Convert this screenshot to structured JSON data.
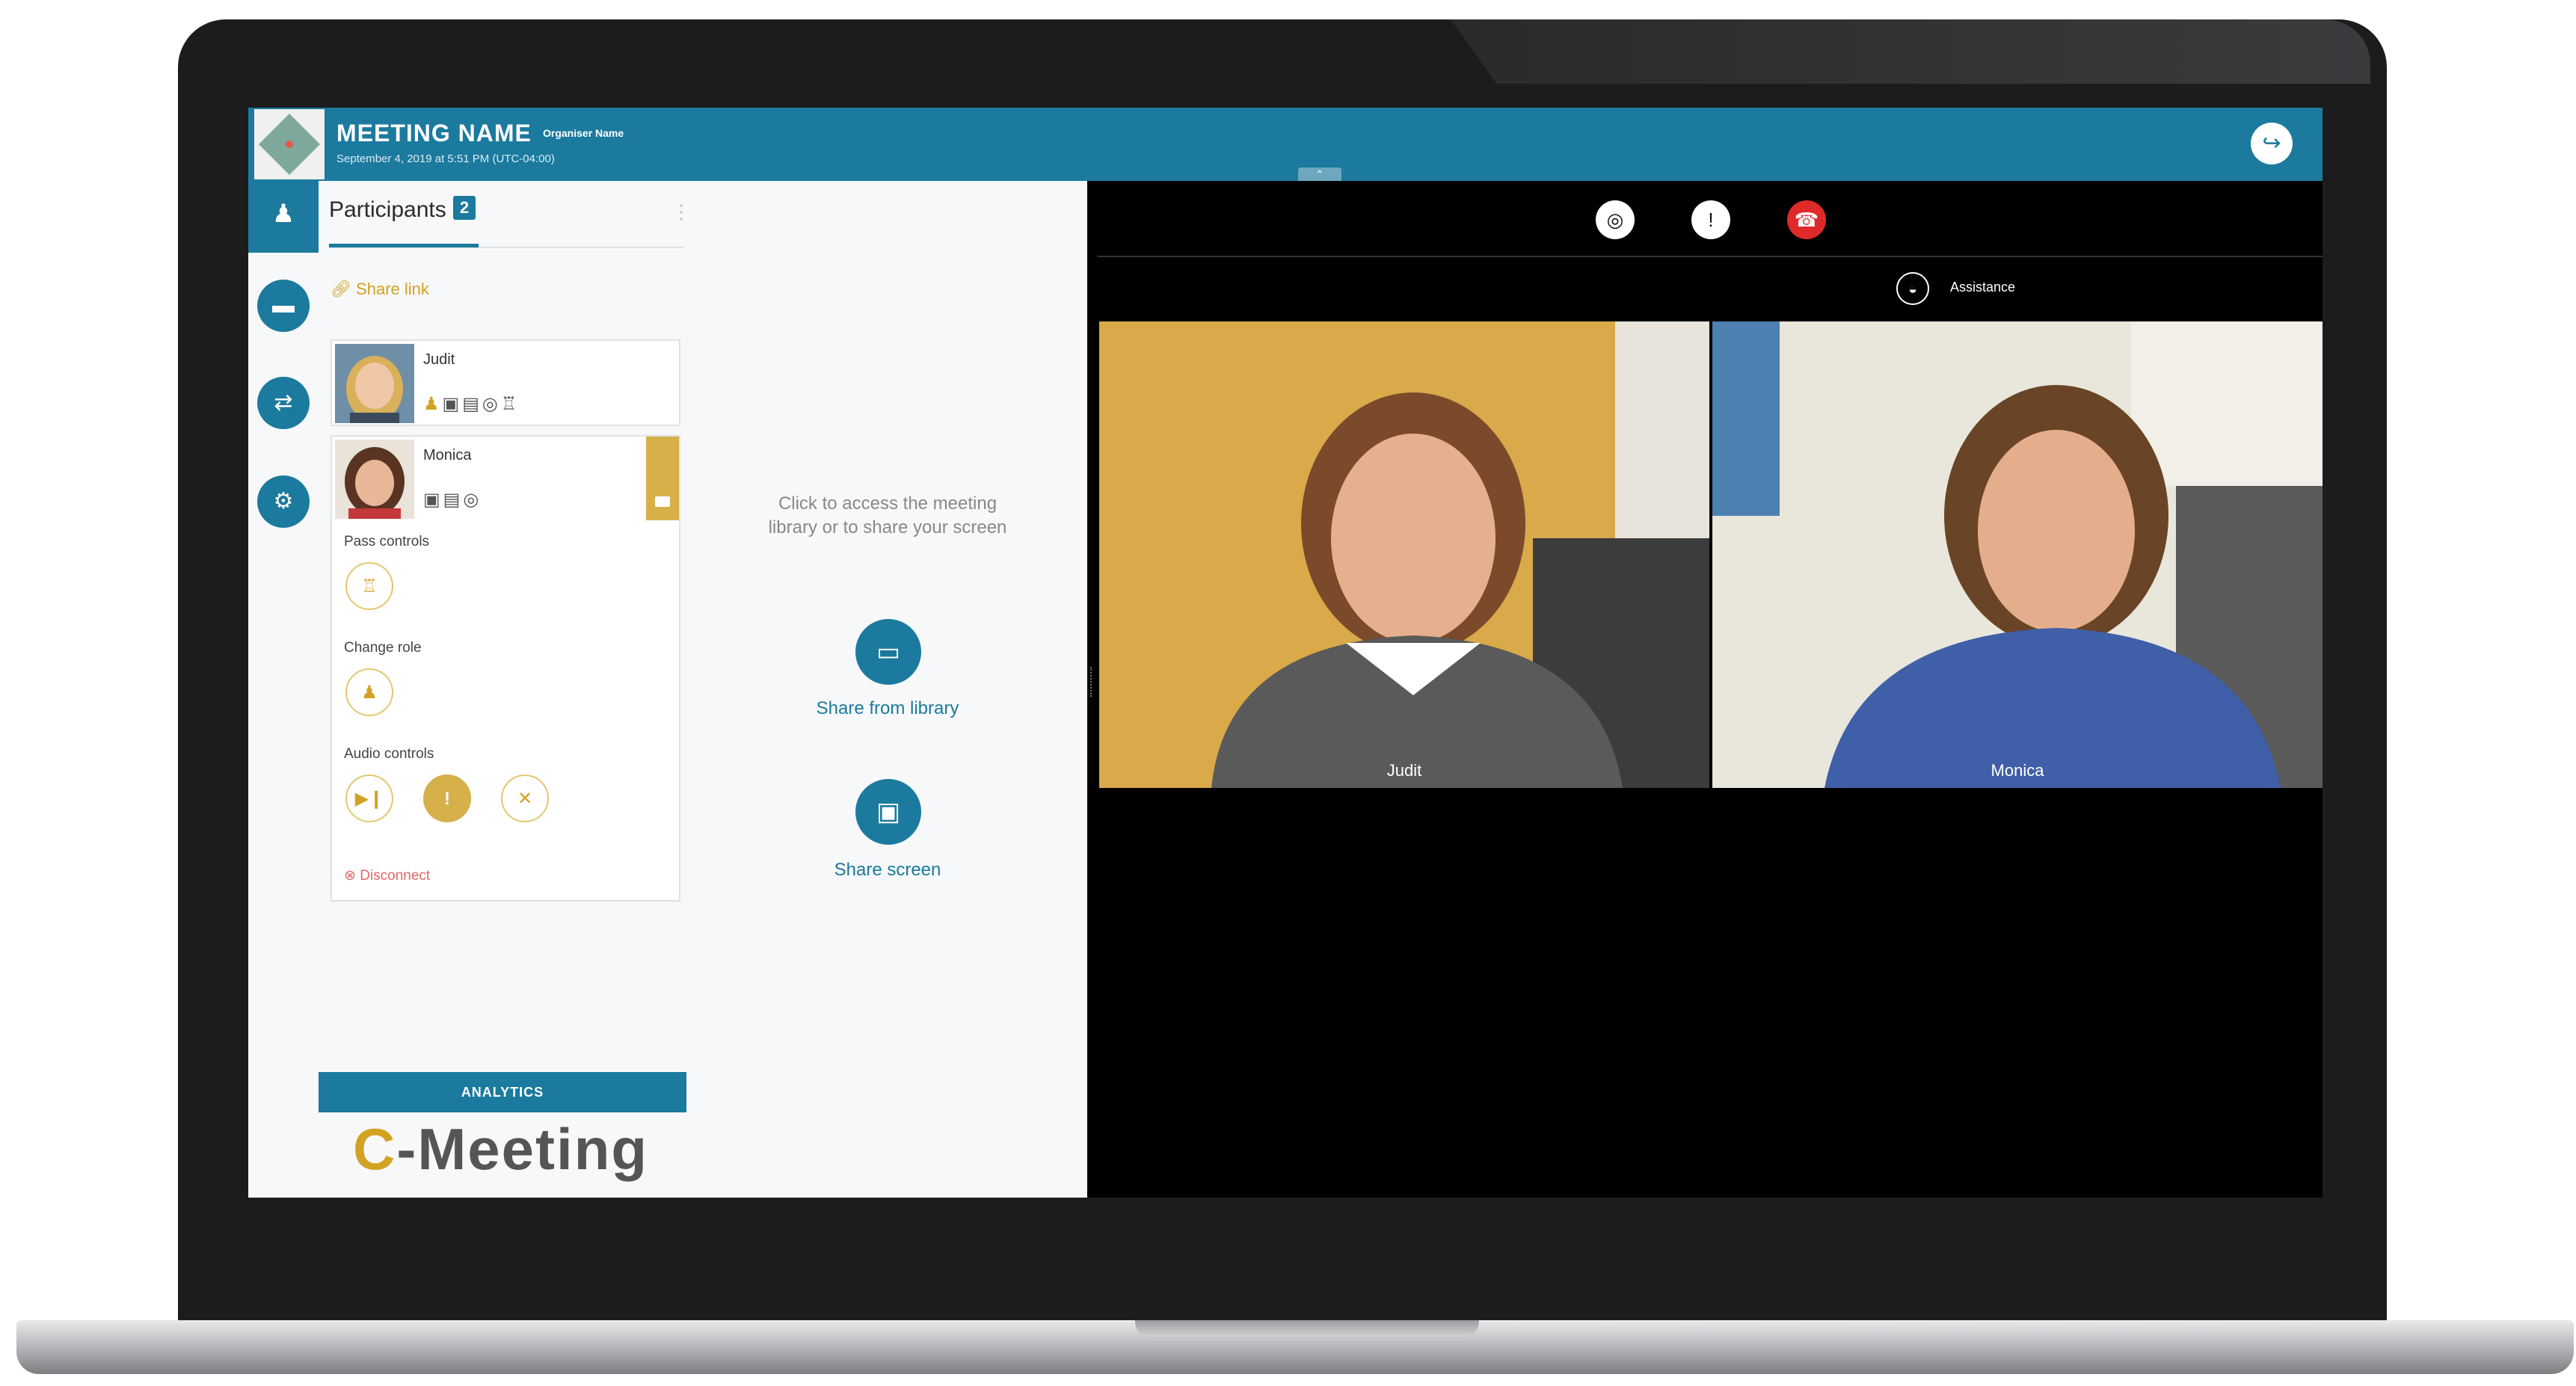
{
  "header": {
    "meeting_name": "MEETING NAME",
    "organiser": "Organiser Name",
    "date": "September 4, 2019 at 5:51 PM (UTC-04:00)"
  },
  "participants": {
    "tab_label": "Participants",
    "count": "2",
    "share_link": "Share link",
    "list": [
      {
        "name": "Judit"
      },
      {
        "name": "Monica"
      }
    ],
    "controls": {
      "pass_controls": "Pass controls",
      "change_role": "Change role",
      "audio_controls": "Audio controls",
      "disconnect": "Disconnect"
    }
  },
  "share": {
    "hint": "Click to access the meeting library or to share your screen",
    "library_label": "Share from library",
    "screen_label": "Share screen"
  },
  "sidebar": {
    "analytics_label": "ANALYTICS",
    "brand_c": "C",
    "brand_rest": "-Meeting"
  },
  "video": {
    "assistance_label": "Assistance",
    "tiles": [
      {
        "name": "Judit"
      },
      {
        "name": "Monica"
      }
    ]
  },
  "colors": {
    "primary": "#1b7a9e",
    "accent_gold": "#d2a222",
    "hangup_red": "#e02a2a"
  },
  "icons": [
    "camera-icon",
    "microphone-icon",
    "hangup-icon",
    "exit-icon",
    "share-link-icon",
    "chat-icon",
    "swap-icon",
    "settings-icon"
  ]
}
